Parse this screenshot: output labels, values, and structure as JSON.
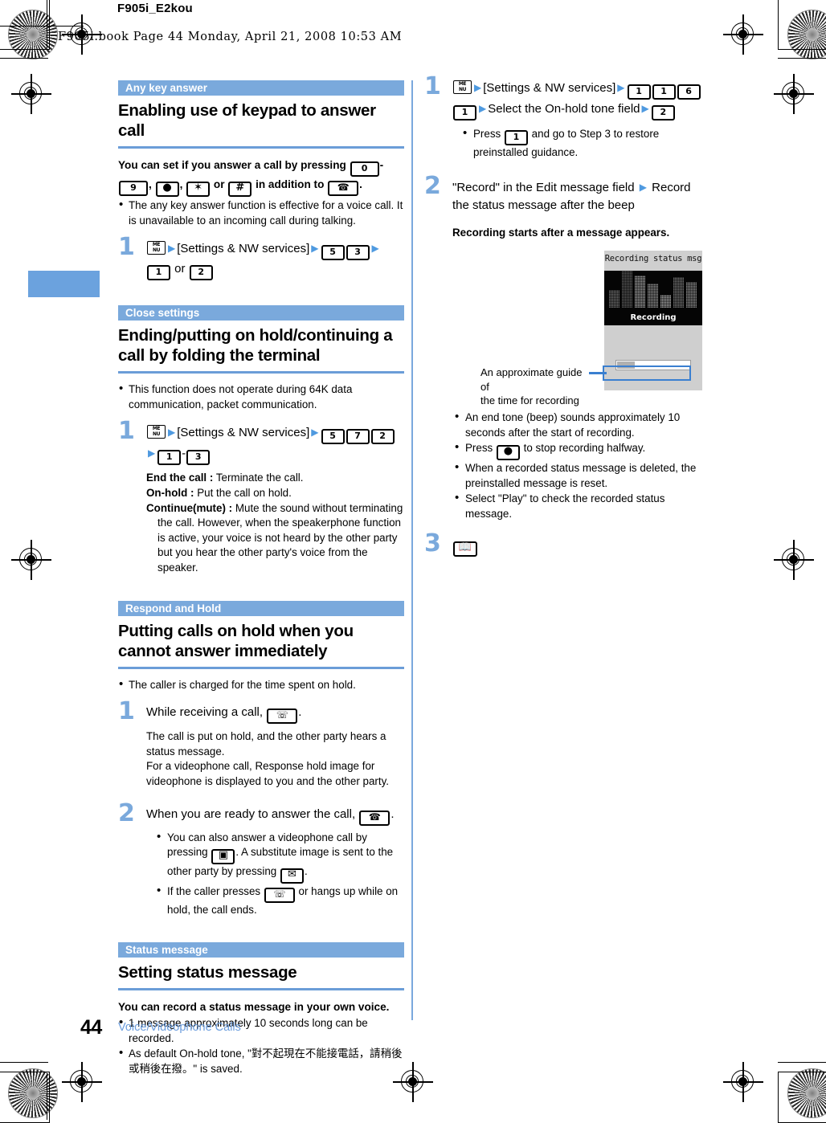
{
  "document": {
    "id": "F905i_E2kou",
    "slug": "F905i.book  Page 44  Monday, April 21, 2008  10:53 AM"
  },
  "footer": {
    "page_number": "44",
    "chapter": "Voice/Videophone Calls"
  },
  "colors": {
    "accent": "#7aa9dc",
    "rule": "#6b9dd8",
    "tag_bg": "#7aa9dc",
    "footer_link": "#6b9ddd",
    "callout": "#3a7fd0",
    "index_tab": "#6ba2de"
  },
  "left_column": {
    "sections": [
      {
        "tag": "Any key answer",
        "title": "Enabling use of keypad to answer call",
        "lead_before": "You can set if you answer a call by pressing",
        "lead_keys_1": [
          "0",
          "9"
        ],
        "lead_mid": ",",
        "lead_keys_2": [
          "●",
          "✶",
          "#"
        ],
        "lead_after": "in addition to",
        "lead_key_end": "tel",
        "bullets": [
          "The any key answer function is effective for a voice call. It is unavailable to an incoming call during talking."
        ],
        "steps": [
          {
            "num": "1",
            "menu_key": "MENU",
            "menu_label": "[Settings & NW services]",
            "keys": [
              "5",
              "3"
            ],
            "keys2": [
              "1",
              "2"
            ],
            "or_word": "or"
          }
        ]
      },
      {
        "tag": "Close settings",
        "title": "Ending/putting on hold/continuing a call by folding the terminal",
        "bullets": [
          "This function does not operate during 64K data communication, packet communication."
        ],
        "steps": [
          {
            "num": "1",
            "menu_key": "MENU",
            "menu_label": "[Settings & NW services]",
            "keys": [
              "5",
              "7",
              "2"
            ],
            "range_keys": [
              "1",
              "3"
            ]
          }
        ],
        "definitions": [
          {
            "term": "End the call :",
            "desc": "Terminate the call."
          },
          {
            "term": "On-hold :",
            "desc": "Put the call on hold."
          },
          {
            "term": "Continue(mute) :",
            "desc": "Mute the sound without terminating the call. However, when the speakerphone function is active, your voice is not heard by the other party but you hear the other party's voice from the speaker."
          }
        ]
      },
      {
        "tag": "Respond and Hold",
        "title": "Putting calls on hold when you cannot answer immediately",
        "bullets": [
          "The caller is charged for the time spent on hold."
        ],
        "steps": [
          {
            "num": "1",
            "text_before": "While receiving a call,",
            "key": "end-call",
            "text_after": ".",
            "notes": [
              "The call is put on hold, and the other party hears a status message.",
              "For a videophone call, Response hold image for videophone is displayed to you and the other party."
            ]
          },
          {
            "num": "2",
            "text_before": "When you are ready to answer the call,",
            "key": "tel",
            "text_after": ".",
            "bullets": [
              "You can also answer a videophone call by pressing [camera]. A substitute image is sent to the other party by pressing [mail].",
              "If the caller presses [end] or hangs up while on hold, the call ends."
            ]
          }
        ]
      },
      {
        "tag": "Status message",
        "title": "Setting status message",
        "lead": "You can record a status message in your own voice.",
        "bullets": [
          "1 message approximately 10 seconds long can be recorded.",
          "As default On-hold tone, \"對不起現在不能接電話，請稍後或稍後在撥。\" is saved."
        ]
      }
    ]
  },
  "right_column": {
    "steps": [
      {
        "num": "1",
        "menu_key": "MENU",
        "menu_label": "[Settings & NW services]",
        "keys": [
          "1",
          "1",
          "6",
          "1"
        ],
        "mid_text": "Select the On-hold tone field",
        "final_key": "2",
        "bullets": [
          "Press [1] and go to Step 3 to restore preinstalled guidance."
        ],
        "bullet_key": "1"
      },
      {
        "num": "2",
        "text": "\"Record\" in the Edit message field ▶ Record the status message after the beep",
        "note": "Recording starts after a message appears."
      },
      {
        "num": "3",
        "key": "book"
      }
    ],
    "after_shot_bullets": [
      "An end tone (beep) sounds approximately 10 seconds after the start of recording.",
      "Press [●] to stop recording halfway.",
      "When a recorded status message is deleted, the preinstalled message is reset.",
      "Select \"Play\" to check the recorded status message."
    ]
  },
  "screenshot": {
    "title": "Recording status msg",
    "status_label": "Recording",
    "callout": "An approximate guide of the time for recording",
    "callout_line1": "An approximate guide of",
    "callout_line2": "the time for recording",
    "progress_percent": 25,
    "equalizer_heights": [
      22,
      46,
      40,
      30,
      16,
      38,
      32
    ]
  }
}
